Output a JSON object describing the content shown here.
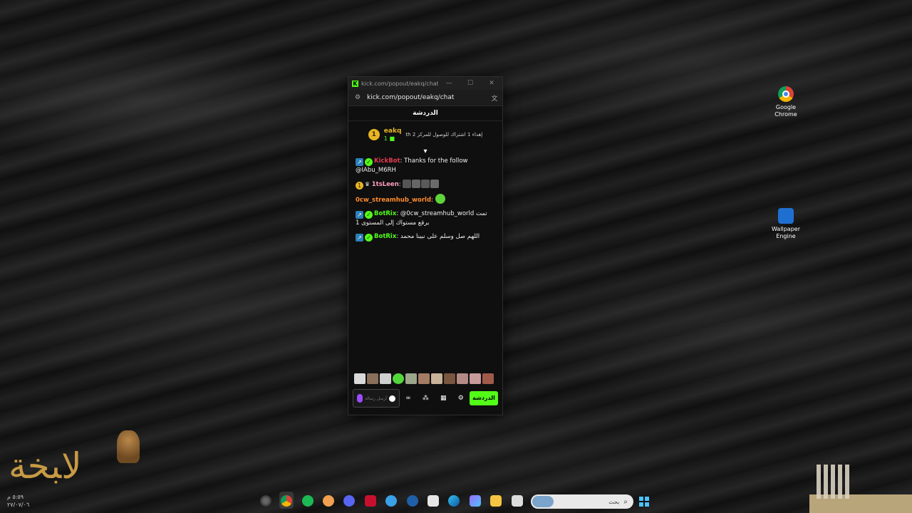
{
  "desktop": {
    "icons": [
      {
        "label_line1": "Google",
        "label_line2": "Chrome",
        "icon": "chrome-icon"
      },
      {
        "label_line1": "Wallpaper",
        "label_line2": "Engine",
        "icon": "wallpaper-engine-icon"
      }
    ]
  },
  "popup": {
    "window_title": "kick.com/popout/eakq/chat...",
    "url": "kick.com/popout/eakq/chat",
    "header": "الدردشة",
    "pinned": {
      "user": "eakq",
      "count": "1",
      "rank_badge": "1",
      "text": "th إهداء 1 اشتراك للوصول للمركز 2"
    },
    "messages": [
      {
        "user": "KickBot",
        "text": ": Thanks for the follow @IAbu_M6RH"
      },
      {
        "user": "1tsLeen",
        "text": ":"
      },
      {
        "user": "0cw_streamhub_world",
        "text": ":"
      },
      {
        "user": "BotRix",
        "text": ": @0cw_streamhub_world تمت برقع مستواك إلى المستوى 1"
      },
      {
        "user": "BotRix",
        "text": ": اللهم صل وسلم على نبينا محمد"
      }
    ],
    "composer": {
      "placeholder": "أرسل رسالة",
      "send_label": "الدردشة"
    }
  },
  "taskbar": {
    "search_placeholder": "بحث",
    "clock_time": "٥:٥٩ م",
    "clock_date": "٢٧/٠٧/٠٦"
  },
  "colors": {
    "kick_green": "#53fc18",
    "gold": "#e7b525"
  }
}
